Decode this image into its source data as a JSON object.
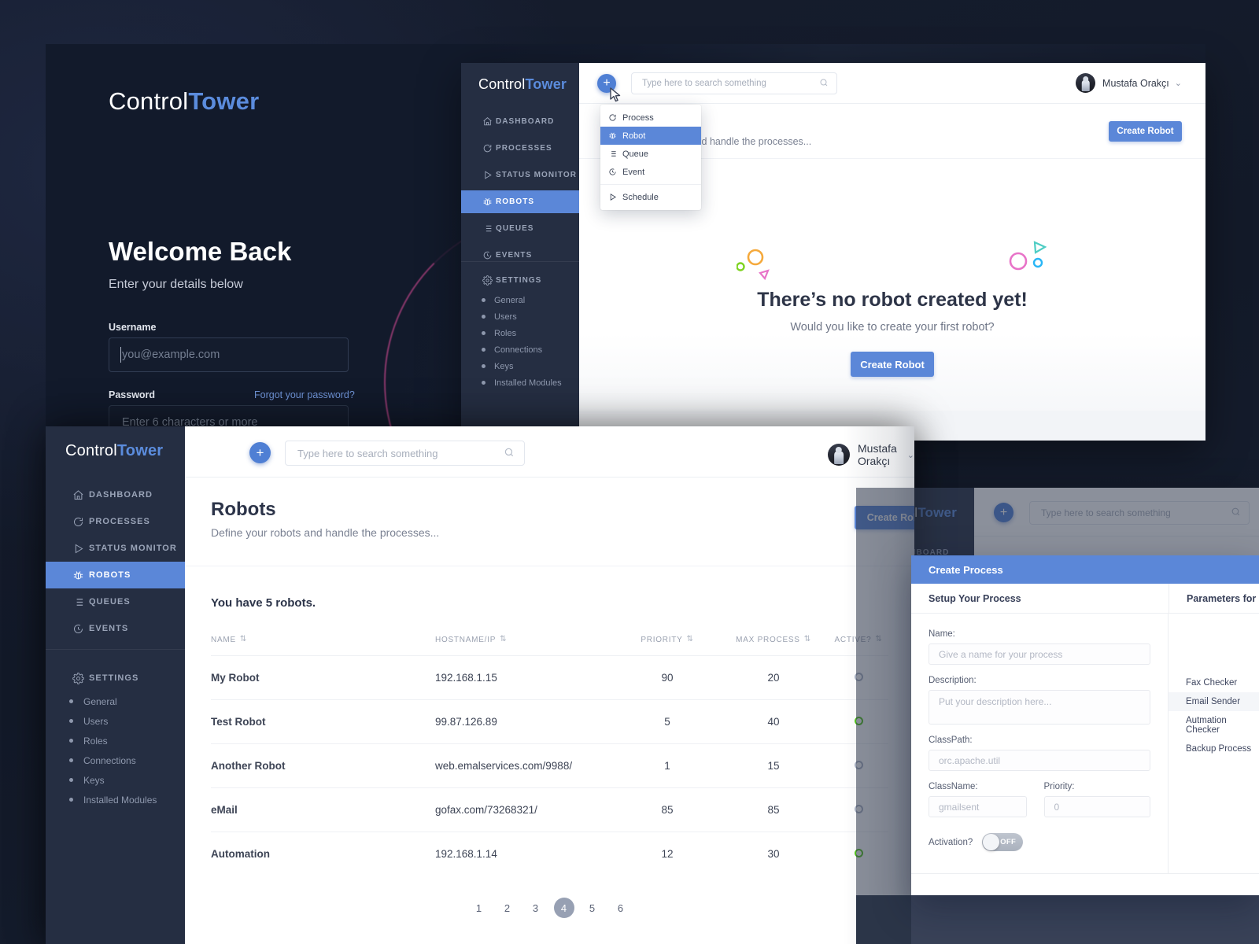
{
  "brand": {
    "name_light": "Control",
    "name_bold": "Tower"
  },
  "login": {
    "heading": "Welcome Back",
    "subheading": "Enter your details below",
    "username_label": "Username",
    "username_placeholder": "you@example.com",
    "password_label": "Password",
    "forgot_link": "Forgot your password?",
    "password_placeholder": "Enter 6 characters or more"
  },
  "sidebar": {
    "items": [
      {
        "label": "DASHBOARD",
        "icon": "home-icon",
        "active": false
      },
      {
        "label": "PROCESSES",
        "icon": "process-icon",
        "active": false
      },
      {
        "label": "STATUS MONITOR",
        "icon": "play-icon",
        "active": false
      },
      {
        "label": "ROBOTS",
        "icon": "robot-icon",
        "active": true
      },
      {
        "label": "QUEUES",
        "icon": "list-icon",
        "active": false
      },
      {
        "label": "EVENTS",
        "icon": "clock-icon",
        "active": false
      }
    ],
    "settings_label": "SETTINGS",
    "settings_icon": "gear-icon",
    "sub_items": [
      {
        "label": "General"
      },
      {
        "label": "Users"
      },
      {
        "label": "Roles"
      },
      {
        "label": "Connections"
      },
      {
        "label": "Keys"
      },
      {
        "label": "Installed Modules"
      }
    ]
  },
  "topbar": {
    "add_label": "+",
    "search_placeholder": "Type here to search something",
    "search_value": "",
    "search_icon": "search-icon",
    "user_name": "Mustafa Orakçı",
    "chevron": "⌄"
  },
  "create_menu": {
    "items": [
      {
        "label": "Process",
        "icon": "process-icon",
        "selected": false
      },
      {
        "label": "Robot",
        "icon": "robot-icon",
        "selected": true
      },
      {
        "label": "Queue",
        "icon": "list-icon",
        "selected": false
      },
      {
        "label": "Event",
        "icon": "clock-icon",
        "selected": false
      }
    ],
    "footer_items": [
      {
        "label": "Schedule",
        "icon": "play-icon",
        "selected": false
      }
    ]
  },
  "robots_page": {
    "title": "Robots",
    "subtitle": "Define your robots and handle the processes...",
    "create_button": "Create Robot",
    "count_text": "You have 5 robots.",
    "columns": [
      "NAME",
      "HOSTNAME/IP",
      "PRIORITY",
      "MAX PROCESS",
      "ACTIVE?"
    ],
    "rows": [
      {
        "name": "My Robot",
        "host": "192.168.1.15",
        "priority": "90",
        "max_process": "20",
        "active": false
      },
      {
        "name": "Test Robot",
        "host": "99.87.126.89",
        "priority": "5",
        "max_process": "40",
        "active": true
      },
      {
        "name": "Another Robot",
        "host": "web.emalservices.com/9988/",
        "priority": "1",
        "max_process": "15",
        "active": false
      },
      {
        "name": "eMail",
        "host": "gofax.com/73268321/",
        "priority": "85",
        "max_process": "85",
        "active": false
      },
      {
        "name": "Automation",
        "host": "192.168.1.14",
        "priority": "12",
        "max_process": "30",
        "active": true
      }
    ],
    "pagination": {
      "pages": [
        "1",
        "2",
        "3",
        "4",
        "5",
        "6"
      ],
      "current": "4"
    }
  },
  "empty_state": {
    "title": "There’s no robot created yet!",
    "subtitle": "Would you like to create your first robot?",
    "button": "Create Robot",
    "decor_colors": [
      "#f5a93b",
      "#7ed321",
      "#e873c8",
      "#4ecdc4",
      "#29b6f6"
    ]
  },
  "create_process_modal": {
    "title": "Create Process",
    "tab_left": "Setup Your Process",
    "tab_right": "Parameters for",
    "fields": {
      "name_label": "Name:",
      "name_placeholder": "Give a name for your process",
      "description_label": "Description:",
      "description_placeholder": "Put your description here...",
      "classpath_label": "ClassPath:",
      "classpath_placeholder": "orc.apache.util",
      "classname_label": "ClassName:",
      "classname_placeholder": "gmailsent",
      "priority_label": "Priority:",
      "priority_placeholder": "0",
      "activation_label": "Activation?",
      "activation_state": "OFF"
    },
    "parameters": [
      {
        "label": "Fax Checker",
        "selected": false
      },
      {
        "label": "Email Sender",
        "selected": true
      },
      {
        "label": "Autmation Checker",
        "selected": false
      },
      {
        "label": "Backup Process",
        "selected": false
      }
    ]
  },
  "colors": {
    "accent": "#5b87d8",
    "sidebar": "#252e42",
    "active_green": "#52c41a",
    "page_bg": "#161d2e"
  }
}
